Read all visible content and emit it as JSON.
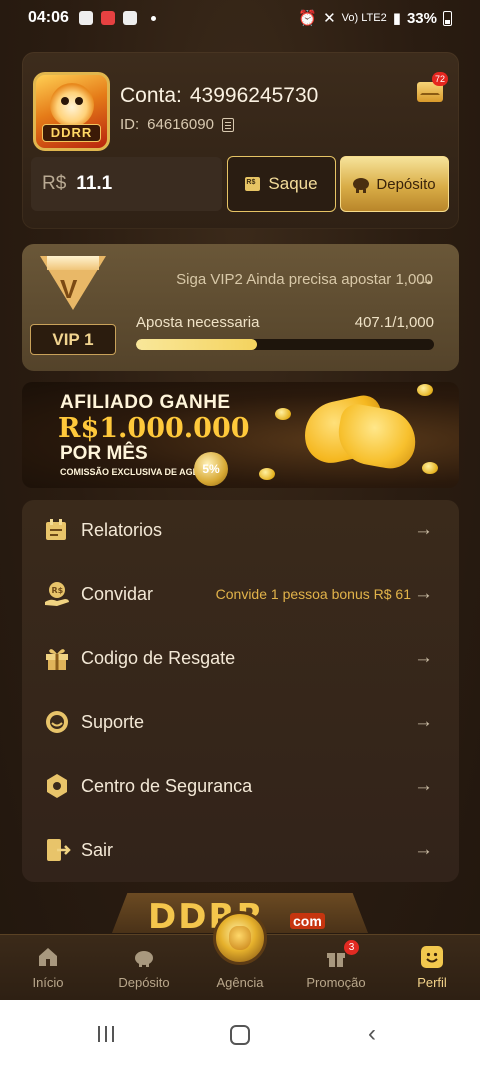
{
  "status_bar": {
    "time": "04:06",
    "network": "Vo) LTE2",
    "battery": "33%"
  },
  "account": {
    "label": "Conta:",
    "number": "43996245730",
    "id_label": "ID:",
    "id_value": "64616090",
    "mail_count": "72",
    "avatar_logo": "DDRR",
    "currency": "R$",
    "balance": "11.1",
    "withdraw_label": "Saque",
    "deposit_label": "Depósito"
  },
  "vip": {
    "level_label": "VIP 1",
    "message": "Siga VIP2 Ainda precisa apostar 1,000",
    "bet_label": "Aposta necessaria",
    "bet_value": "407.1/1,000",
    "progress_fraction": 0.407
  },
  "banner": {
    "line1": "AFILIADO GANHE",
    "line2": "R$1.000.000",
    "line3": "POR MÊS",
    "line4": "COMISSÃO EXCLUSIVA DE AGENTE",
    "percent": "5%"
  },
  "menu": {
    "items": [
      {
        "label": "Relatorios",
        "extra": "",
        "icon": "report-icon"
      },
      {
        "label": "Convidar",
        "extra": "Convide 1 pessoa bonus R$ 61",
        "icon": "invite-coin-icon"
      },
      {
        "label": "Codigo de Resgate",
        "extra": "",
        "icon": "gift-icon"
      },
      {
        "label": "Suporte",
        "extra": "",
        "icon": "support-icon"
      },
      {
        "label": "Centro de Seguranca",
        "extra": "",
        "icon": "security-icon"
      },
      {
        "label": "Sair",
        "extra": "",
        "icon": "exit-icon"
      }
    ],
    "arrow": "→"
  },
  "footer_logo": {
    "text": "DDRR",
    "suffix": "com"
  },
  "bottom_nav": {
    "items": [
      {
        "label": "Início",
        "icon": "home-icon"
      },
      {
        "label": "Depósito",
        "icon": "piggy-bank-icon"
      },
      {
        "label": "Agência",
        "icon": "money-bag-icon"
      },
      {
        "label": "Promoção",
        "icon": "gift-icon"
      },
      {
        "label": "Perfil",
        "icon": "smiley-icon"
      }
    ],
    "active": "Perfil",
    "promo_badge": "3"
  },
  "colors": {
    "accent_gold": "#e6c465",
    "background": "#2a1d12",
    "progress": "#f4d35e",
    "badge_red": "#e22a22"
  }
}
